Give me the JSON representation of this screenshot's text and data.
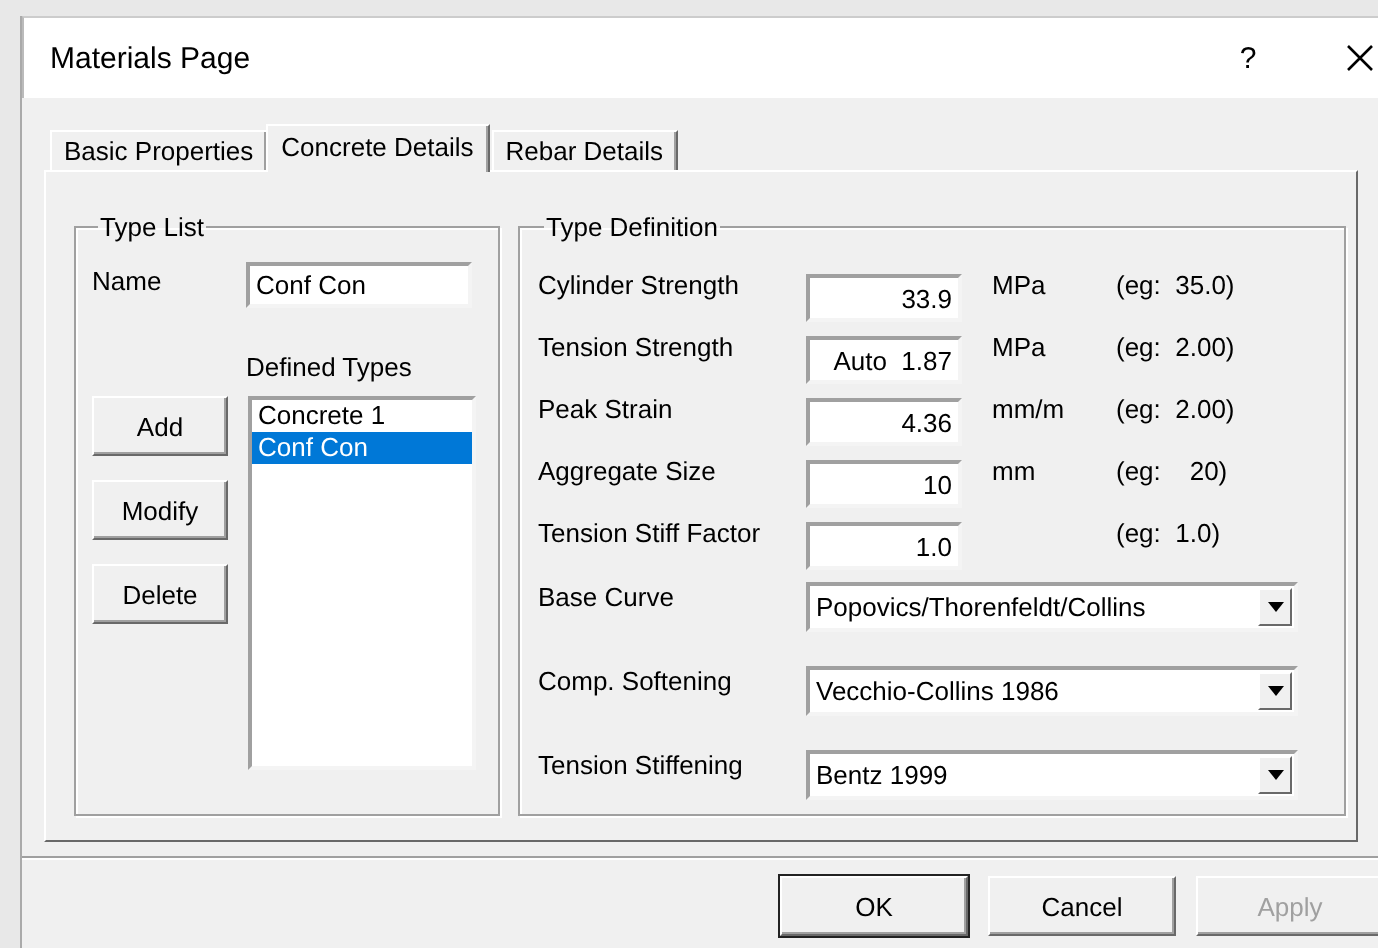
{
  "window": {
    "title": "Materials Page",
    "help": "?"
  },
  "tabs": [
    {
      "label": "Basic Properties",
      "selected": false
    },
    {
      "label": "Concrete Details",
      "selected": true
    },
    {
      "label": "Rebar Details",
      "selected": false
    }
  ],
  "type_list": {
    "title": "Type List",
    "name_label": "Name",
    "name_value": "Conf Con",
    "defined_label": "Defined Types",
    "items": [
      {
        "label": "Concrete 1",
        "selected": false
      },
      {
        "label": "Conf Con",
        "selected": true
      }
    ],
    "buttons": [
      "Add",
      "Modify",
      "Delete"
    ]
  },
  "type_definition": {
    "title": "Type Definition",
    "fields": [
      {
        "label": "Cylinder Strength",
        "value": "33.9",
        "unit": "MPa",
        "example": "(eg:  35.0)"
      },
      {
        "label": "Tension Strength",
        "value": "Auto  1.87",
        "unit": "MPa",
        "example": "(eg:  2.00)"
      },
      {
        "label": "Peak Strain",
        "value": "4.36",
        "unit": "mm/m",
        "example": "(eg:  2.00)"
      },
      {
        "label": "Aggregate Size",
        "value": "10",
        "unit": "mm",
        "example": "(eg:    20)"
      },
      {
        "label": "Tension Stiff Factor",
        "value": "1.0",
        "example": "(eg:  1.0)"
      }
    ],
    "dropdowns": [
      {
        "label": "Base Curve",
        "value": "Popovics/Thorenfeldt/Collins"
      },
      {
        "label": "Comp. Softening",
        "value": "Vecchio-Collins 1986"
      },
      {
        "label": "Tension Stiffening",
        "value": "Bentz 1999"
      }
    ]
  },
  "buttons": [
    {
      "label": "OK",
      "default": true,
      "disabled": false
    },
    {
      "label": "Cancel",
      "default": false,
      "disabled": false
    },
    {
      "label": "Apply",
      "default": false,
      "disabled": true
    }
  ]
}
